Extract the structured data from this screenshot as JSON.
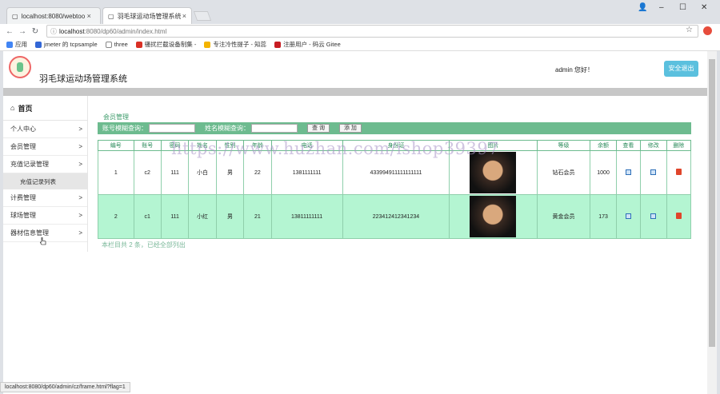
{
  "browser": {
    "tabs": [
      {
        "label": "localhost:8080/webtoo",
        "close": "×"
      },
      {
        "label": "羽毛球运动场管理系统",
        "close": "×"
      }
    ],
    "window_controls": [
      "–",
      "☐",
      "✕"
    ],
    "url_host": "localhost",
    "url_path": ":8080/dp60/admin/index.html",
    "bookmarks": [
      {
        "label": "应用",
        "color": "#4285f4"
      },
      {
        "label": "jmeter 的 tcpsample",
        "color": "#3367d6"
      },
      {
        "label": "three",
        "color": "#888888"
      },
      {
        "label": "骚扰拦截设备制集 -",
        "color": "#d93025"
      },
      {
        "label": "专注冷性提子 - 知蕊",
        "color": "#f4b400"
      },
      {
        "label": "注册用户 - 码云 Gitee",
        "color": "#c71d23"
      }
    ],
    "status_url": "localhost:8080/dp60/admin/cz/frame.html?flag=1"
  },
  "header": {
    "title": "羽毛球运动场管理系统",
    "greeting": "admin 您好！",
    "logout_label": "安全退出"
  },
  "sidebar": {
    "home": "首页",
    "items": [
      {
        "label": "个人中心",
        "arrow": ">"
      },
      {
        "label": "会员管理",
        "arrow": ">"
      },
      {
        "label": "充值记录管理",
        "arrow": ">"
      }
    ],
    "sub_item": "充值记录列表",
    "items2": [
      {
        "label": "计费管理",
        "arrow": ">"
      },
      {
        "label": "球场管理",
        "arrow": ">"
      },
      {
        "label": "器材信息管理",
        "arrow": ">"
      }
    ]
  },
  "main": {
    "section_title": "会员管理",
    "search": {
      "label_account": "账号模糊查询：",
      "label_name": "姓名模糊查询：",
      "search_button": "查 询",
      "add_button": "添 加"
    },
    "table": {
      "headers": [
        "编号",
        "账号",
        "密码",
        "姓名",
        "性别",
        "年龄",
        "电话",
        "身份证",
        "图片",
        "等级",
        "余额",
        "查看",
        "修改",
        "删除"
      ],
      "rows": [
        {
          "id": "1",
          "account": "c2",
          "password": "111",
          "name": "小白",
          "gender": "男",
          "age": "22",
          "phone": "1381111111",
          "idcard": "433994911111111111",
          "level": "钻石会员",
          "balance": "1000"
        },
        {
          "id": "2",
          "account": "c1",
          "password": "111",
          "name": "小红",
          "gender": "男",
          "age": "21",
          "phone": "13811111111",
          "idcard": "223412412341234",
          "level": "黄金会员",
          "balance": "173"
        }
      ]
    },
    "footer_note": "本栏目共 2 条，已经全部列出"
  },
  "watermark": "https://www.huzhan.com/ishop39397",
  "colors": {
    "accent": "#6dbb8f",
    "row_highlight": "#b4f5d2",
    "logout": "#5bc0de"
  }
}
